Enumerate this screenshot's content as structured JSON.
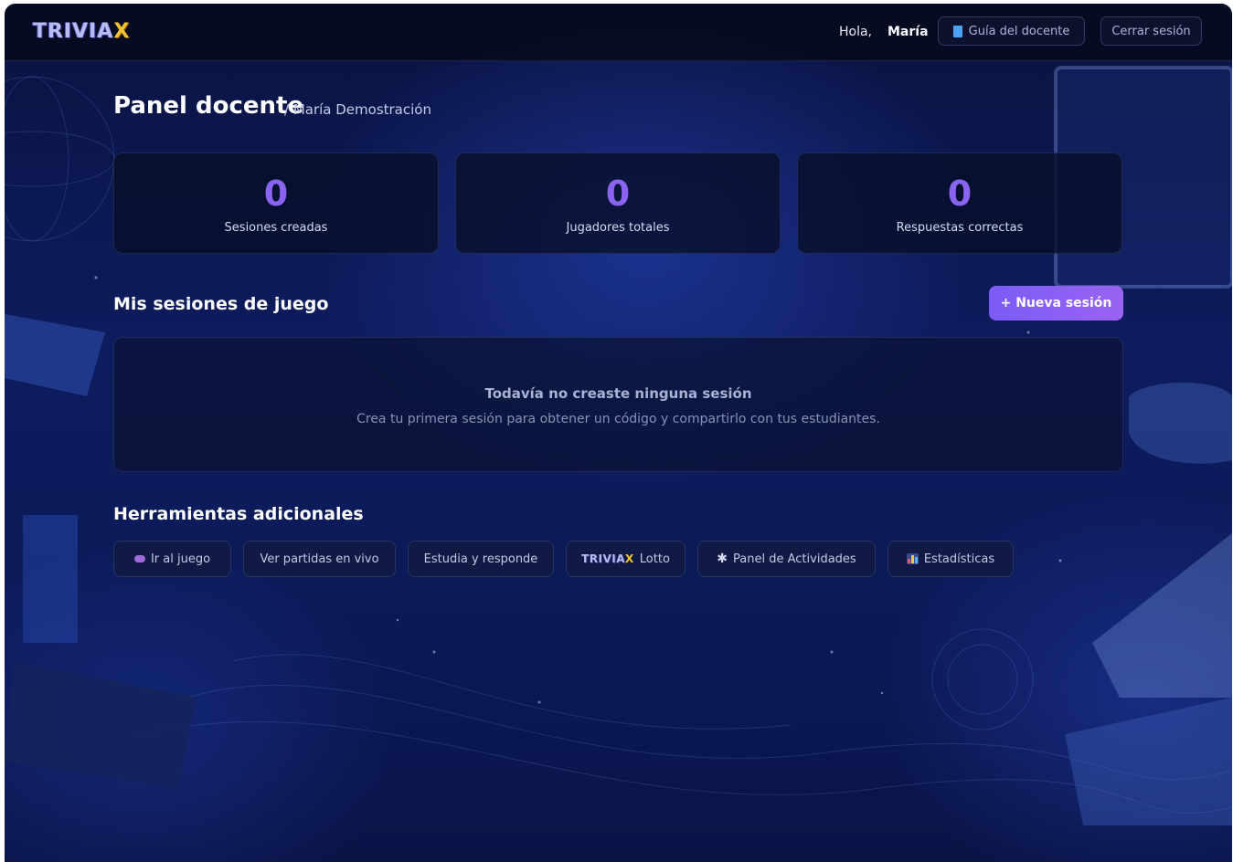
{
  "header": {
    "greeting": "Hola,",
    "user_name": "María",
    "guide_label": "Guía del docente",
    "logout_label": "Cerrar sesión"
  },
  "logo": {
    "text": "TRIVIA",
    "accent": "X"
  },
  "page": {
    "title": "Panel docente",
    "subtitle": "/ María Demostración"
  },
  "stats": [
    {
      "value": "0",
      "label": "Sesiones creadas"
    },
    {
      "value": "0",
      "label": "Jugadores totales"
    },
    {
      "value": "0",
      "label": "Respuestas correctas"
    }
  ],
  "sessions": {
    "title": "Mis sesiones de juego",
    "new_label": "+ Nueva sesión",
    "empty_title": "Todavía no creaste ninguna sesión",
    "empty_desc": "Crea tu primera sesión para obtener un código y compartirlo con tus estudiantes."
  },
  "tools": {
    "title": "Herramientas adicionales",
    "items": [
      {
        "label": "Ir al juego",
        "icon": "gamepad-icon"
      },
      {
        "label": "Ver partidas en vivo"
      },
      {
        "label": "Estudia y responde"
      },
      {
        "label": "Lotto",
        "icon": "triviax-logo"
      },
      {
        "label": "Panel de Actividades",
        "icon": "gear-icon"
      },
      {
        "label": "Estadísticas",
        "icon": "bar-chart-icon"
      }
    ]
  },
  "colors": {
    "accent": "#8a63f0",
    "logo_x": "#f4c430",
    "background": "#0d1c5e"
  }
}
